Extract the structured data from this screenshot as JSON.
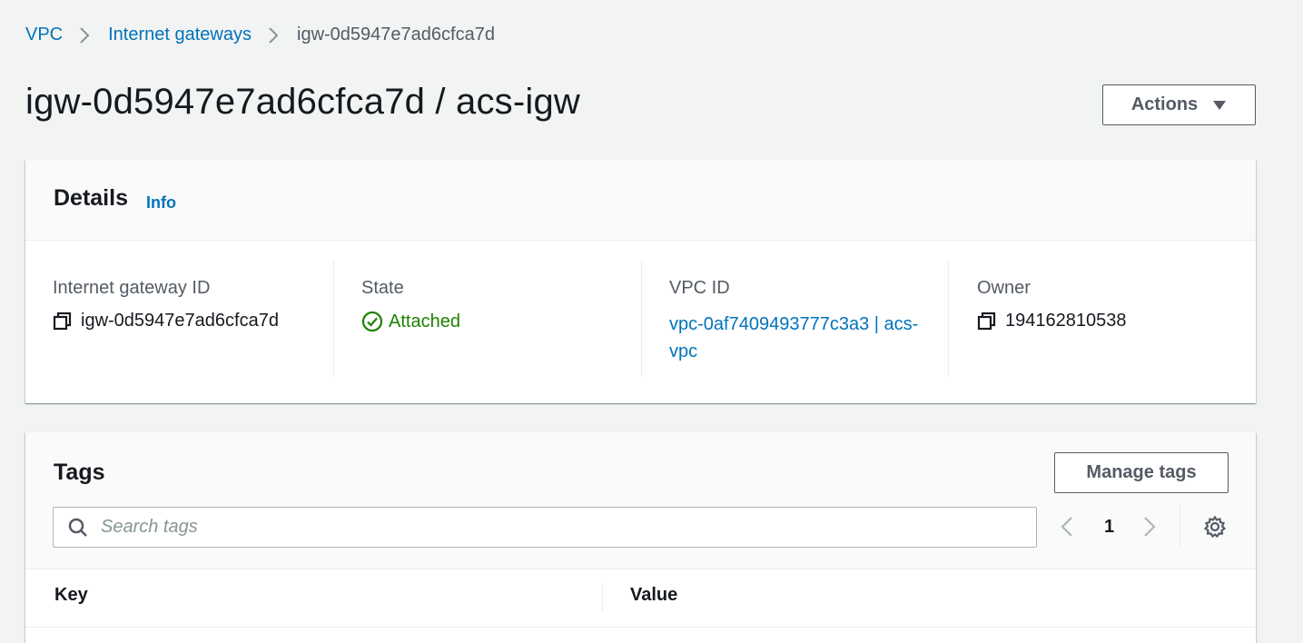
{
  "breadcrumb": {
    "items": [
      "VPC",
      "Internet gateways"
    ],
    "current": "igw-0d5947e7ad6cfca7d"
  },
  "page": {
    "title": "igw-0d5947e7ad6cfca7d / acs-igw",
    "actions_label": "Actions"
  },
  "details": {
    "heading": "Details",
    "info_label": "Info",
    "fields": {
      "igw_id": {
        "label": "Internet gateway ID",
        "value": "igw-0d5947e7ad6cfca7d"
      },
      "state": {
        "label": "State",
        "value": "Attached"
      },
      "vpc_id": {
        "label": "VPC ID",
        "value": "vpc-0af7409493777c3a3 | acs-vpc"
      },
      "owner": {
        "label": "Owner",
        "value": "194162810538"
      }
    }
  },
  "tags": {
    "heading": "Tags",
    "manage_label": "Manage tags",
    "search_placeholder": "Search tags",
    "page_number": "1",
    "columns": [
      "Key",
      "Value"
    ]
  },
  "icons": {
    "breadcrumb_separator": "chevron-right-icon",
    "actions_caret": "caret-down-icon",
    "copy": "copy-icon",
    "status": "check-circle-icon",
    "search": "search-icon",
    "prev": "chevron-left-icon",
    "next": "chevron-right-icon",
    "settings": "gear-icon"
  },
  "colors": {
    "link": "#0073bb",
    "success": "#1d8102",
    "background": "#f2f3f3",
    "text": "#16191f",
    "secondary_text": "#545b64"
  }
}
